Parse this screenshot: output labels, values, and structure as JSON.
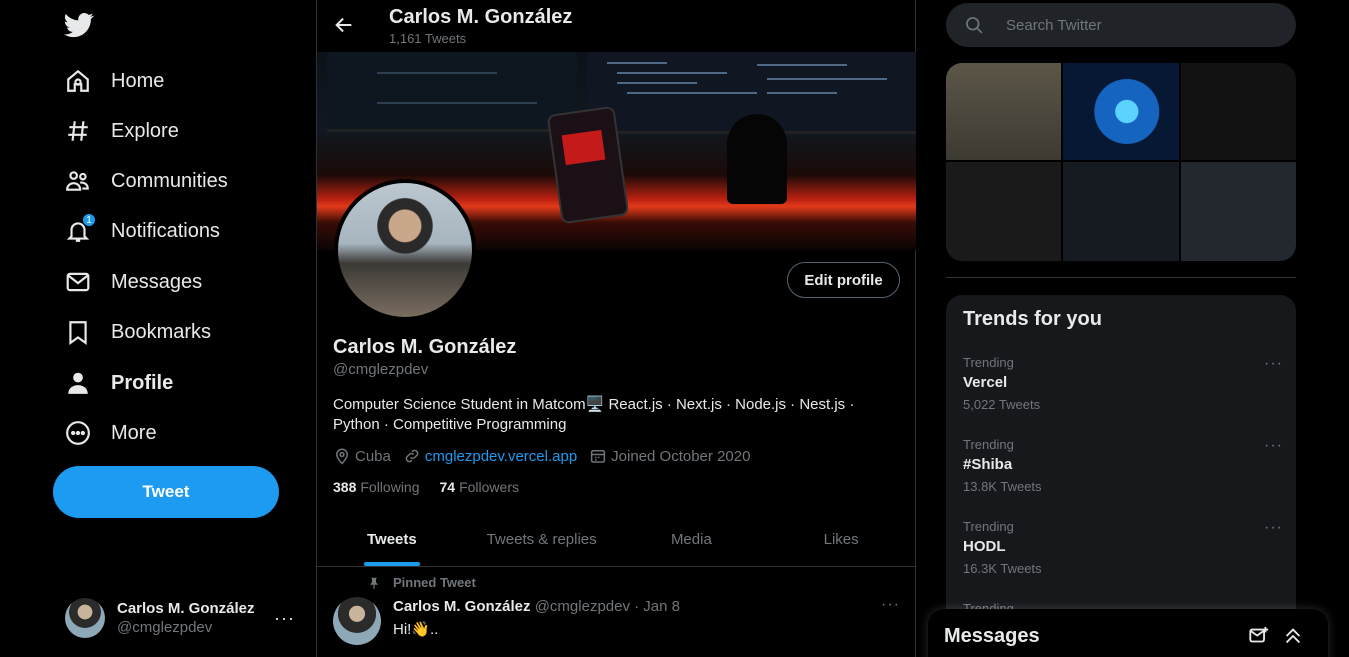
{
  "nav": {
    "items": [
      {
        "label": "Home",
        "icon": "home-icon"
      },
      {
        "label": "Explore",
        "icon": "hashtag-icon"
      },
      {
        "label": "Communities",
        "icon": "communities-icon"
      },
      {
        "label": "Notifications",
        "icon": "bell-icon",
        "badge": "1"
      },
      {
        "label": "Messages",
        "icon": "envelope-icon"
      },
      {
        "label": "Bookmarks",
        "icon": "bookmark-icon"
      },
      {
        "label": "Profile",
        "icon": "person-icon",
        "active": true
      },
      {
        "label": "More",
        "icon": "more-circle-icon"
      }
    ],
    "tweet_button": "Tweet"
  },
  "account": {
    "name": "Carlos M. González",
    "handle": "@cmglezpdev",
    "more": "···"
  },
  "header": {
    "name": "Carlos M. González",
    "tweet_count": "1,161 Tweets"
  },
  "profile": {
    "edit_button": "Edit profile",
    "name": "Carlos M. González",
    "handle": "@cmglezpdev",
    "bio_line1": "Computer Science Student in Matcom🖥️  React.js · Next.js · Node.js · Nest.js ·",
    "bio_line2": "Python · Competitive Programming",
    "location": "Cuba",
    "website": "cmglezpdev.vercel.app",
    "joined": "Joined October 2020",
    "following_count": "388",
    "following_label": "Following",
    "followers_count": "74",
    "followers_label": "Followers"
  },
  "tabs": [
    "Tweets",
    "Tweets & replies",
    "Media",
    "Likes"
  ],
  "pinned_tweet": {
    "pinned_label": "Pinned Tweet",
    "name": "Carlos M. González",
    "handle_date": "@cmglezpdev · Jan 8",
    "text": "Hi!👋..",
    "more": "···"
  },
  "search": {
    "placeholder": "Search Twitter"
  },
  "trends": {
    "title": "Trends for you",
    "items": [
      {
        "context": "Trending",
        "name": "Vercel",
        "count": "5,022 Tweets"
      },
      {
        "context": "Trending",
        "name": "#Shiba",
        "count": "13.8K Tweets"
      },
      {
        "context": "Trending",
        "name": "HODL",
        "count": "16.3K Tweets"
      },
      {
        "context": "Trending",
        "name": "",
        "count": ""
      }
    ],
    "more": "···"
  },
  "messages_dock": {
    "title": "Messages"
  },
  "colors": {
    "accent": "#1d9bf0",
    "background": "#000000",
    "secondary_text": "#71767b"
  }
}
